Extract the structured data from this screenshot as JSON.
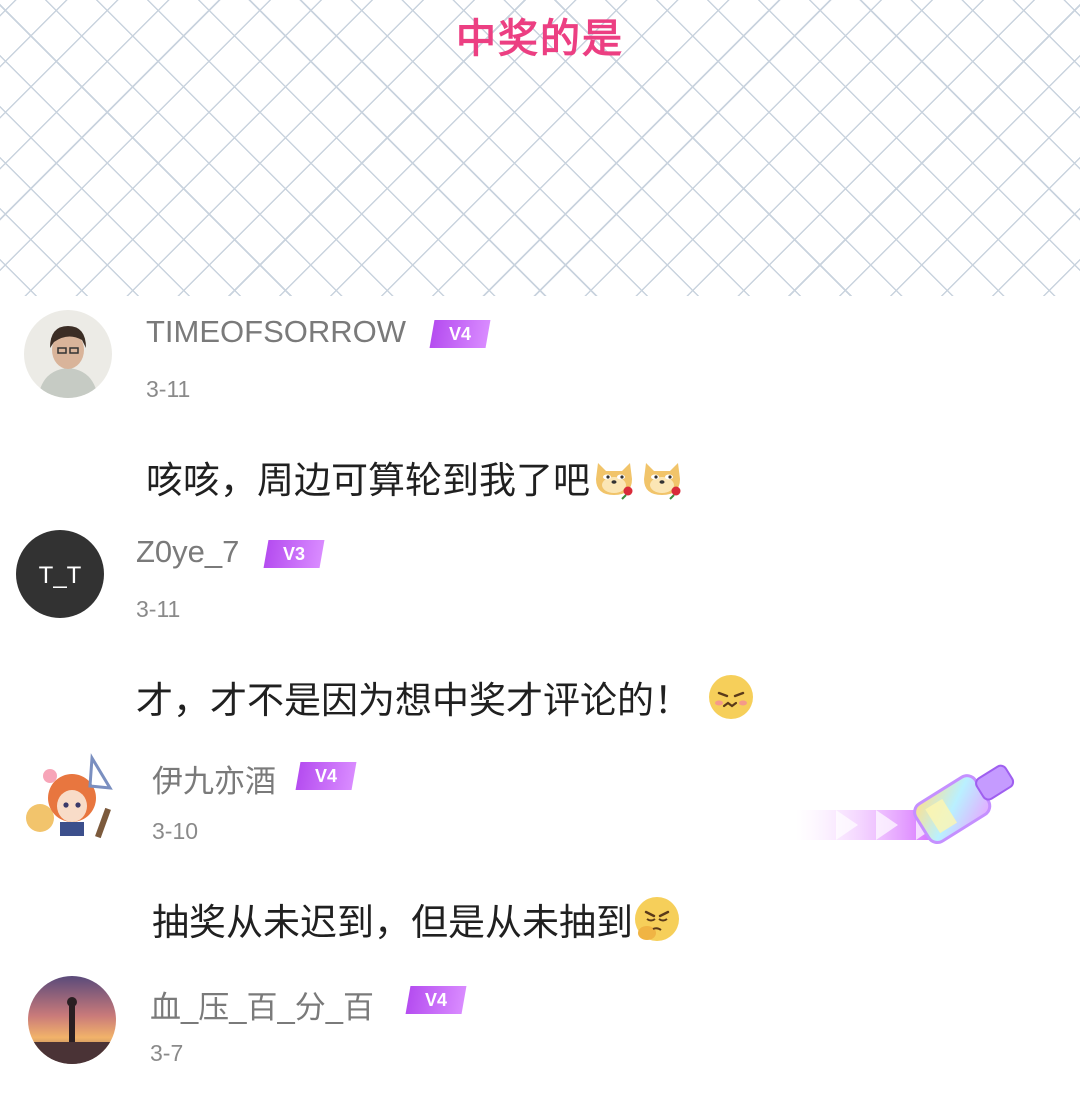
{
  "header": {
    "title": "中奖的是"
  },
  "comments": [
    {
      "username": "TIMEOFSORROW",
      "level": "V4",
      "date": "3-11",
      "text": "咳咳，周边可算轮到我了吧",
      "emojis": [
        "doge-rose-icon",
        "doge-rose-icon"
      ]
    },
    {
      "username": "Z0ye_7",
      "level": "V3",
      "date": "3-11",
      "text": "才，才不是因为想中奖才评论的！",
      "avatar_text": "T_T",
      "emojis": [
        "tsundere-face-icon"
      ]
    },
    {
      "username": "伊九亦酒",
      "level": "V4",
      "date": "3-10",
      "text": "抽奖从未迟到，但是从未抽到",
      "emojis": [
        "sulk-face-icon"
      ]
    },
    {
      "username": "血_压_百_分_百",
      "level": "V4",
      "date": "3-7"
    }
  ],
  "colors": {
    "title": "#ec3f82",
    "badge": "#c061f5",
    "text": "#202020",
    "meta": "#8a8a8a"
  }
}
